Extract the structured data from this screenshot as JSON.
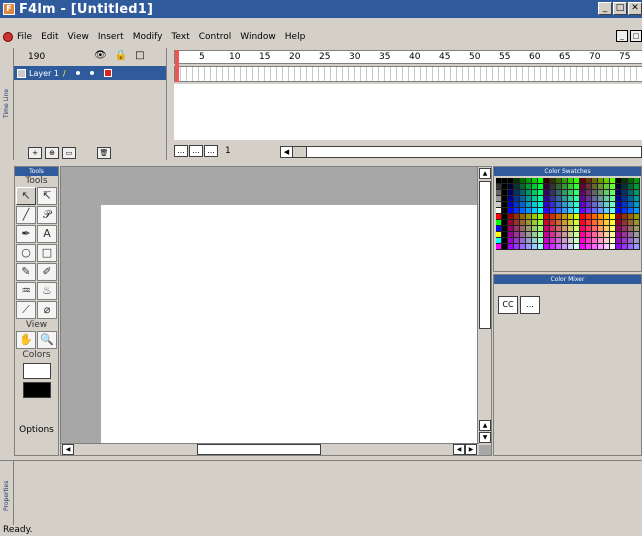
{
  "app": {
    "title": "F4lm  - [Untitled1]",
    "icon_letter": "F"
  },
  "window_buttons": [
    "_",
    "□",
    "✕"
  ],
  "menu": [
    "File",
    "Edit",
    "View",
    "Insert",
    "Modify",
    "Text",
    "Control",
    "Window",
    "Help"
  ],
  "timeline": {
    "side_label": "Time Line",
    "frame_count_label": "190",
    "layer_name": "Layer 1",
    "ruler_ticks": [
      "5",
      "10",
      "15",
      "20",
      "25",
      "30",
      "35",
      "40",
      "45",
      "50",
      "55",
      "60",
      "65",
      "70",
      "75"
    ],
    "current_frame": "1",
    "nav_buttons": [
      "...",
      "...",
      "..."
    ]
  },
  "tools": {
    "header": "Tools",
    "section_tools": "Tools",
    "section_view": "View",
    "section_colors": "Colors",
    "section_options": "Options",
    "items": [
      {
        "name": "arrow",
        "glyph": "↖"
      },
      {
        "name": "subselect",
        "glyph": "↸"
      },
      {
        "name": "line",
        "glyph": "╱"
      },
      {
        "name": "lasso",
        "glyph": "𝒫"
      },
      {
        "name": "pen",
        "glyph": "✒"
      },
      {
        "name": "text",
        "glyph": "A"
      },
      {
        "name": "oval",
        "glyph": "○"
      },
      {
        "name": "rectangle",
        "glyph": "□"
      },
      {
        "name": "pencil",
        "glyph": "✎"
      },
      {
        "name": "brush",
        "glyph": "✐"
      },
      {
        "name": "ink-bottle",
        "glyph": "♒"
      },
      {
        "name": "paint-bucket",
        "glyph": "♨"
      },
      {
        "name": "eyedropper",
        "glyph": "⟋"
      },
      {
        "name": "eraser",
        "glyph": "⌀"
      }
    ],
    "view_items": [
      {
        "name": "hand",
        "glyph": "✋"
      },
      {
        "name": "zoom",
        "glyph": "🔍"
      }
    ],
    "stroke_color": "#ffffff",
    "fill_color": "#000000"
  },
  "color_swatches": {
    "title": "Color Swatches"
  },
  "color_mixer": {
    "title": "Color Mixer",
    "buttons": [
      "CC",
      "..."
    ]
  },
  "properties": {
    "side_label": "Properties"
  },
  "status": "Ready."
}
